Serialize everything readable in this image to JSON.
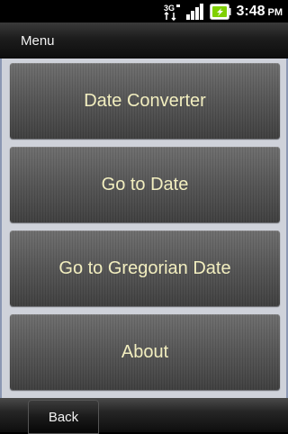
{
  "status_bar": {
    "network_icon": "3g-data-icon",
    "network_text": "3G",
    "signal_icon": "signal-strength-icon",
    "battery_icon": "battery-charging-icon",
    "time": "3:48",
    "ampm": "PM"
  },
  "title_bar": {
    "title": "Menu"
  },
  "menu": {
    "items": [
      {
        "label": "Date Converter"
      },
      {
        "label": "Go to Date"
      },
      {
        "label": "Go to Gregorian Date"
      },
      {
        "label": "About"
      }
    ]
  },
  "bottom_bar": {
    "back_label": "Back"
  },
  "colors": {
    "button_text": "#f2eebf",
    "content_background": "#cfd2da",
    "content_border": "#8b97b3",
    "battery_accent": "#7fd000"
  }
}
